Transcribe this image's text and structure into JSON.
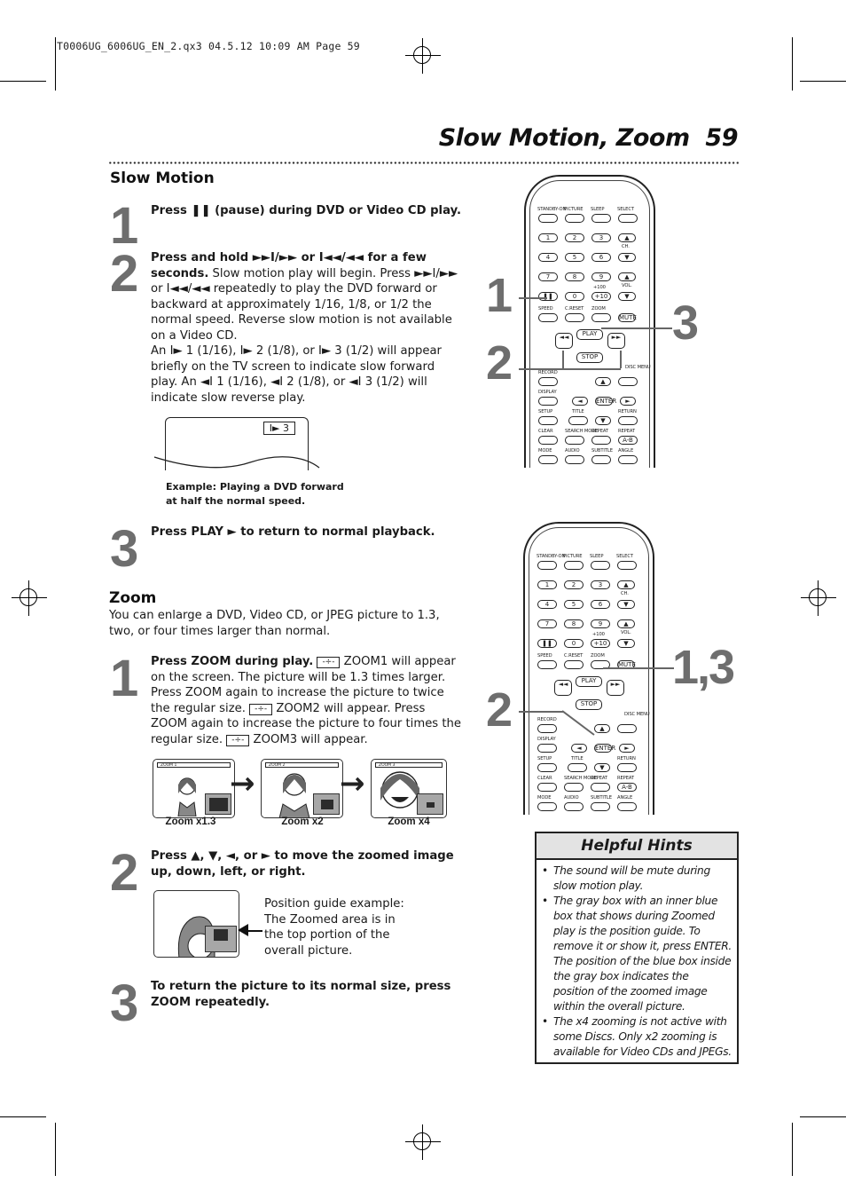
{
  "print_slug": "T0006UG_6006UG_EN_2.qx3  04.5.12  10:09 AM  Page 59",
  "header": {
    "title": "Slow Motion, Zoom",
    "page_number": "59"
  },
  "slow_motion": {
    "heading": "Slow Motion",
    "steps": [
      {
        "number": "1",
        "bold": "Press ❚❚ (pause) during DVD or Video CD play.",
        "text": ""
      },
      {
        "number": "2",
        "bold": "Press and hold ►►I/►► or I◄◄/◄◄ for a few seconds.",
        "text": " Slow motion play will begin. Press ►►I/►► or I◄◄/◄◄ repeatedly to play the DVD forward or backward at approximately 1/16, 1/8, or 1/2 the normal speed.  Reverse slow motion is not available on a Video CD.",
        "text2": "An I► 1 (1/16), I► 2 (1/8), or I► 3 (1/2) will appear briefly on the TV screen to indicate slow forward play. An ◄I 1 (1/16), ◄I 2 (1/8), or ◄I 3 (1/2) will indicate slow reverse play."
      },
      {
        "number": "3",
        "bold": "Press PLAY ► to return to normal playback.",
        "text": ""
      }
    ],
    "example_screen_badge": "I► 3",
    "example_caption_line1": "Example: Playing a DVD forward",
    "example_caption_line2": "at half the normal speed.",
    "callouts": [
      "1",
      "2",
      "3"
    ]
  },
  "zoom": {
    "heading": "Zoom",
    "intro": "You can enlarge a DVD, Video CD, or JPEG picture to 1.3, two, or four times larger than normal.",
    "step1": {
      "number": "1",
      "bold": "Press ZOOM during play.",
      "p1": " ZOOM1 will appear on the screen.  The picture will be 1.3 times larger. Press ZOOM again to increase the picture to twice the regular size. ",
      "p2": " ZOOM2 will appear. Press ZOOM again to increase the picture to four times the regular size. ",
      "p3": " ZOOM3 will appear.",
      "icon_glyph": "-÷-"
    },
    "examples": [
      {
        "osd": "ZOOM 1",
        "label": "Zoom x1.3"
      },
      {
        "osd": "ZOOM 2",
        "label": "Zoom x2"
      },
      {
        "osd": "ZOOM 3",
        "label": "Zoom x4"
      }
    ],
    "step2": {
      "number": "2",
      "bold": "Press ▲, ▼, ◄, or ► to move the zoomed image up, down, left, or right."
    },
    "position_guide": "Position guide example: The Zoomed area is in the top portion of the overall picture.",
    "step3": {
      "number": "3",
      "bold": "To return the picture to its normal size, press ZOOM repeatedly."
    },
    "callouts": [
      "1,3",
      "2"
    ]
  },
  "remote": {
    "row1_labels": [
      "STANDBY-ON",
      "PICTURE",
      "SLEEP",
      "SELECT"
    ],
    "digits": [
      "1",
      "2",
      "3",
      "4",
      "5",
      "6",
      "7",
      "8",
      "9"
    ],
    "pause": "❚❚",
    "zero": "0",
    "plus10": "+10",
    "plus100": "+100",
    "ch": "CH.",
    "vol": "VOL.",
    "row_speed": [
      "SPEED",
      "C.RESET",
      "ZOOM"
    ],
    "mute": "MUTE",
    "play": "PLAY",
    "stop": "STOP",
    "disc_menu": "DISC MENU",
    "record": "RECORD",
    "display": "DISPLAY",
    "enter": "ENTER",
    "row_setup": [
      "SETUP",
      "TITLE",
      "RETURN"
    ],
    "row_clear": [
      "CLEAR",
      "SEARCH MODE",
      "REPEAT",
      "REPEAT"
    ],
    "ab": "A-B",
    "row_mode": [
      "MODE",
      "AUDIO",
      "SUBTITLE",
      "ANGLE"
    ]
  },
  "hints": {
    "title": "Helpful Hints",
    "items": [
      "The sound will be mute during slow motion play.",
      "The gray box with an inner blue box that shows during Zoomed play is the position guide. To remove it or show it, press ENTER. The position of the blue box inside the gray box indicates the position of the zoomed image within the overall picture.",
      "The x4 zooming is not active with some Discs. Only x2 zooming is available for Video CDs and JPEGs."
    ]
  }
}
